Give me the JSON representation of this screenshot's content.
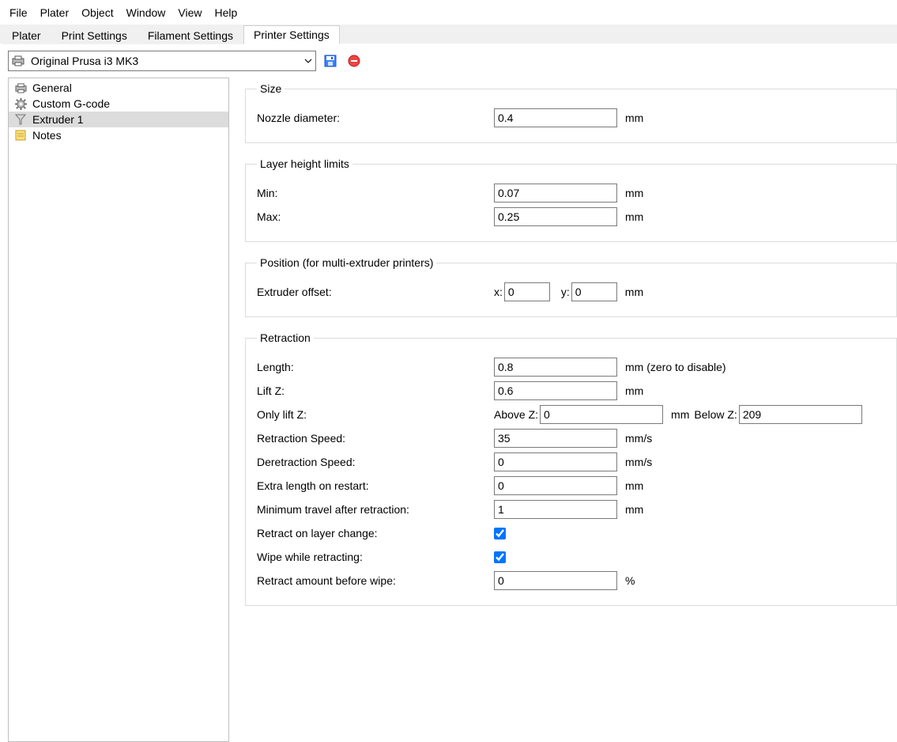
{
  "menu": [
    "File",
    "Plater",
    "Object",
    "Window",
    "View",
    "Help"
  ],
  "tabs": [
    "Plater",
    "Print Settings",
    "Filament Settings",
    "Printer Settings"
  ],
  "active_tab": 3,
  "profile": {
    "name": "Original Prusa i3 MK3"
  },
  "sidebar": {
    "items": [
      {
        "label": "General",
        "icon": "printer"
      },
      {
        "label": "Custom G-code",
        "icon": "gear"
      },
      {
        "label": "Extruder 1",
        "icon": "funnel"
      },
      {
        "label": "Notes",
        "icon": "note"
      }
    ],
    "selected": 2
  },
  "groups": {
    "size": {
      "legend": "Size",
      "nozzle_label": "Nozzle diameter:",
      "nozzle_value": "0.4",
      "nozzle_unit": "mm"
    },
    "layer": {
      "legend": "Layer height limits",
      "min_label": "Min:",
      "min_value": "0.07",
      "min_unit": "mm",
      "max_label": "Max:",
      "max_value": "0.25",
      "max_unit": "mm"
    },
    "position": {
      "legend": "Position (for multi-extruder printers)",
      "offset_label": "Extruder offset:",
      "x_label": "x:",
      "x_value": "0",
      "y_label": "y:",
      "y_value": "0",
      "unit": "mm"
    },
    "retraction": {
      "legend": "Retraction",
      "length_label": "Length:",
      "length_value": "0.8",
      "length_unit": "mm (zero to disable)",
      "liftz_label": "Lift Z:",
      "liftz_value": "0.6",
      "liftz_unit": "mm",
      "onlylift_label": "Only lift Z:",
      "above_label": "Above Z:",
      "above_value": "0",
      "above_unit": "mm",
      "below_label": "Below Z:",
      "below_value": "209",
      "retspeed_label": "Retraction Speed:",
      "retspeed_value": "35",
      "retspeed_unit": "mm/s",
      "deretspeed_label": "Deretraction Speed:",
      "deretspeed_value": "0",
      "deretspeed_unit": "mm/s",
      "extra_label": "Extra length on restart:",
      "extra_value": "0",
      "extra_unit": "mm",
      "mintravel_label": "Minimum travel after retraction:",
      "mintravel_value": "1",
      "mintravel_unit": "mm",
      "retractlayer_label": "Retract on layer change:",
      "retractlayer_checked": true,
      "wipe_label": "Wipe while retracting:",
      "wipe_checked": true,
      "wipeamount_label": "Retract amount before wipe:",
      "wipeamount_value": "0",
      "wipeamount_unit": "%"
    }
  }
}
